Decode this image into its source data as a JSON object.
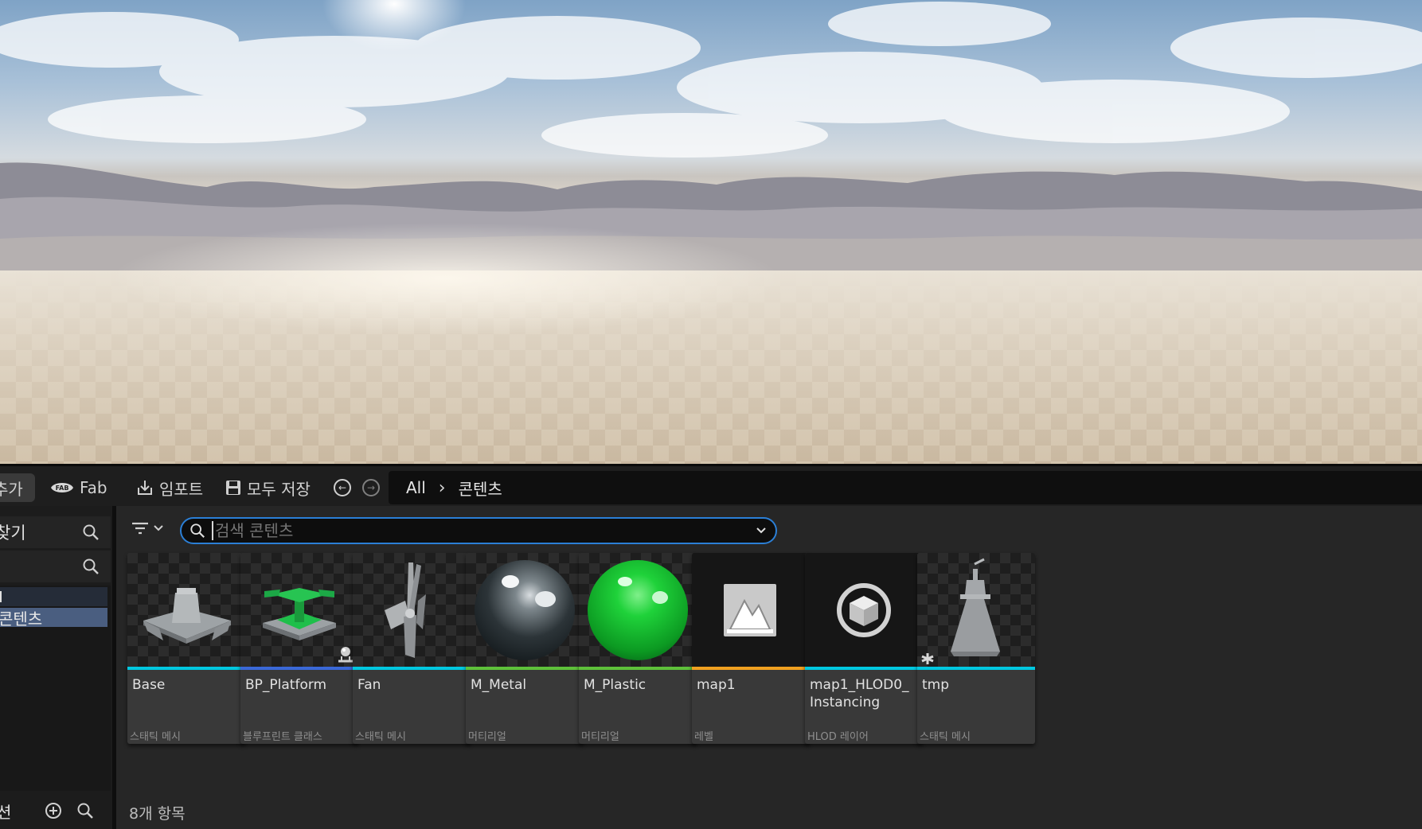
{
  "toolbar": {
    "add_label": "추가",
    "fab_label": "Fab",
    "import_label": "임포트",
    "save_all_label": "모두 저장",
    "breadcrumb": [
      "All",
      "콘텐츠"
    ]
  },
  "left_panel": {
    "favorites_label": "찾기",
    "tree_items": [
      "",
      "콘텐츠"
    ],
    "collections_label": "션"
  },
  "search": {
    "placeholder": "검색 콘텐츠"
  },
  "assets": [
    {
      "name": "Base",
      "type": "스태틱 메시",
      "bar_color": "#00c8e0",
      "icon": "static-mesh-base-icon"
    },
    {
      "name": "BP_Platform",
      "type": "블루프린트 클래스",
      "bar_color": "#3a68d8",
      "icon": "blueprint-platform-icon"
    },
    {
      "name": "Fan",
      "type": "스태틱 메시",
      "bar_color": "#00c8e0",
      "icon": "static-mesh-fan-icon"
    },
    {
      "name": "M_Metal",
      "type": "머티리얼",
      "bar_color": "#5ec13a",
      "icon": "material-metal-sphere-icon"
    },
    {
      "name": "M_Plastic",
      "type": "머티리얼",
      "bar_color": "#5ec13a",
      "icon": "material-plastic-sphere-icon"
    },
    {
      "name": "map1",
      "type": "레벨",
      "bar_color": "#f0a020",
      "icon": "level-mountain-icon"
    },
    {
      "name": "map1_HLOD0_\nInstancing",
      "type": "HLOD 레이어",
      "bar_color": "#00c8e0",
      "icon": "hlod-cube-icon"
    },
    {
      "name": "tmp",
      "type": "스태틱 메시",
      "bar_color": "#00c8e0",
      "icon": "static-mesh-tmp-icon"
    }
  ],
  "status": {
    "item_count": "8개 항목"
  }
}
